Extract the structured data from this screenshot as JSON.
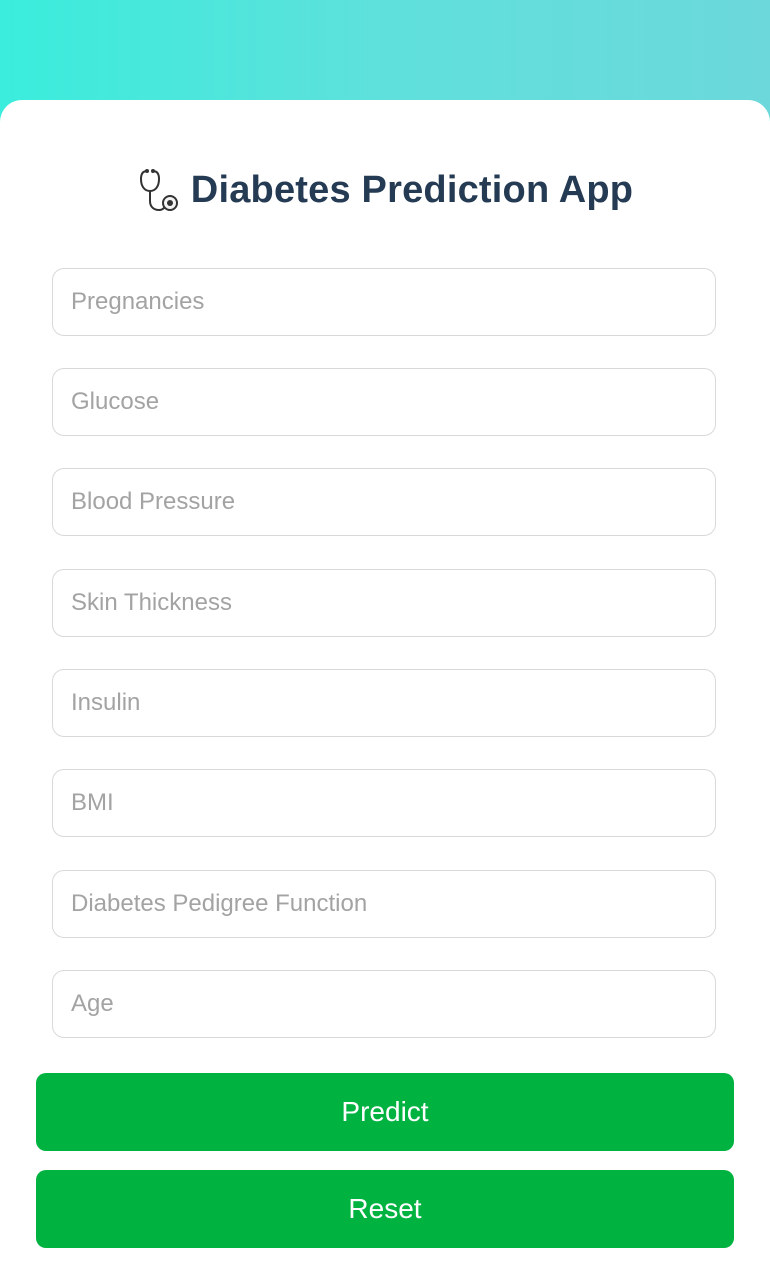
{
  "app": {
    "title": "Diabetes Prediction App",
    "title_icon": "stethoscope-icon"
  },
  "form": {
    "fields": [
      {
        "name": "pregnancies",
        "placeholder": "Pregnancies",
        "value": ""
      },
      {
        "name": "glucose",
        "placeholder": "Glucose",
        "value": ""
      },
      {
        "name": "blood-pressure",
        "placeholder": "Blood Pressure",
        "value": ""
      },
      {
        "name": "skin-thickness",
        "placeholder": "Skin Thickness",
        "value": ""
      },
      {
        "name": "insulin",
        "placeholder": "Insulin",
        "value": ""
      },
      {
        "name": "bmi",
        "placeholder": "BMI",
        "value": ""
      },
      {
        "name": "diabetes-pedigree-function",
        "placeholder": "Diabetes Pedigree Function",
        "value": ""
      },
      {
        "name": "age",
        "placeholder": "Age",
        "value": ""
      }
    ]
  },
  "buttons": {
    "predict_label": "Predict",
    "reset_label": "Reset"
  },
  "colors": {
    "header_gradient_start": "#3aeddc",
    "header_gradient_end": "#6cd8dc",
    "title": "#243b53",
    "button": "#00b341",
    "button_text": "#ffffff",
    "placeholder": "#a3a3a3",
    "field_border": "#d9d9d9"
  }
}
